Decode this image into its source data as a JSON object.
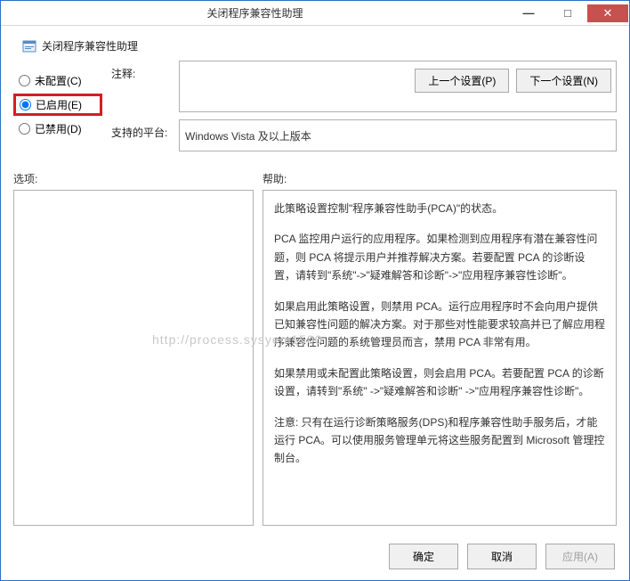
{
  "window": {
    "title": "关闭程序兼容性助理",
    "minimize": "—",
    "maximize": "□",
    "close": "✕"
  },
  "heading": "关闭程序兼容性助理",
  "nav": {
    "prev": "上一个设置(P)",
    "next": "下一个设置(N)"
  },
  "radios": {
    "not_configured": "未配置(C)",
    "enabled": "已启用(E)",
    "disabled": "已禁用(D)",
    "selected": "enabled"
  },
  "fields": {
    "comment_label": "注释:",
    "comment_value": "",
    "platform_label": "支持的平台:",
    "platform_value": "Windows Vista 及以上版本"
  },
  "sections": {
    "options_label": "选项:",
    "help_label": "帮助:"
  },
  "help": {
    "p1": "此策略设置控制\"程序兼容性助手(PCA)\"的状态。",
    "p2": "PCA 监控用户运行的应用程序。如果检测到应用程序有潜在兼容性问题，则 PCA 将提示用户并推荐解决方案。若要配置 PCA 的诊断设置，请转到\"系统\"->\"疑难解答和诊断\"->\"应用程序兼容性诊断\"。",
    "p3": "如果启用此策略设置，则禁用 PCA。运行应用程序时不会向用户提供已知兼容性问题的解决方案。对于那些对性能要求较高并已了解应用程序兼容性问题的系统管理员而言，禁用 PCA 非常有用。",
    "p4": "如果禁用或未配置此策略设置，则会启用 PCA。若要配置 PCA 的诊断设置，请转到\"系统\" ->\"疑难解答和诊断\" ->\"应用程序兼容性诊断\"。",
    "p5": "注意: 只有在运行诊断策略服务(DPS)和程序兼容性助手服务后，才能运行 PCA。可以使用服务管理单元将这些服务配置到 Microsoft 管理控制台。"
  },
  "footer": {
    "ok": "确定",
    "cancel": "取消",
    "apply": "应用(A)"
  },
  "watermark": "http://process.sysyem1500"
}
